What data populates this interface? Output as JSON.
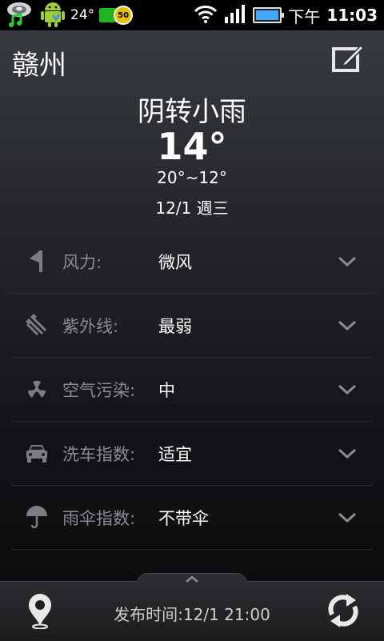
{
  "status_bar": {
    "temperature": "24°",
    "battery_badge": "50",
    "ampm": "下午",
    "time": "11:03"
  },
  "header": {
    "city": "赣州"
  },
  "weather": {
    "condition": "阴转小雨",
    "temperature": "14°",
    "range": "20°~12°",
    "date": "12/1 週三"
  },
  "details": [
    {
      "icon": "flag-icon",
      "label": "风力:",
      "value": "微风"
    },
    {
      "icon": "uv-icon",
      "label": "紫外线:",
      "value": "最弱"
    },
    {
      "icon": "radiation-icon",
      "label": "空气污染:",
      "value": "中"
    },
    {
      "icon": "car-icon",
      "label": "洗车指数:",
      "value": "适宜"
    },
    {
      "icon": "umbrella-icon",
      "label": "雨伞指数:",
      "value": "不带伞"
    }
  ],
  "footer": {
    "publish_time": "发布时间:12/1 21:00"
  },
  "colors": {
    "label": "#8a8c90",
    "battery_green": "#1fb51f",
    "battery_blue": "#43a6ff"
  }
}
